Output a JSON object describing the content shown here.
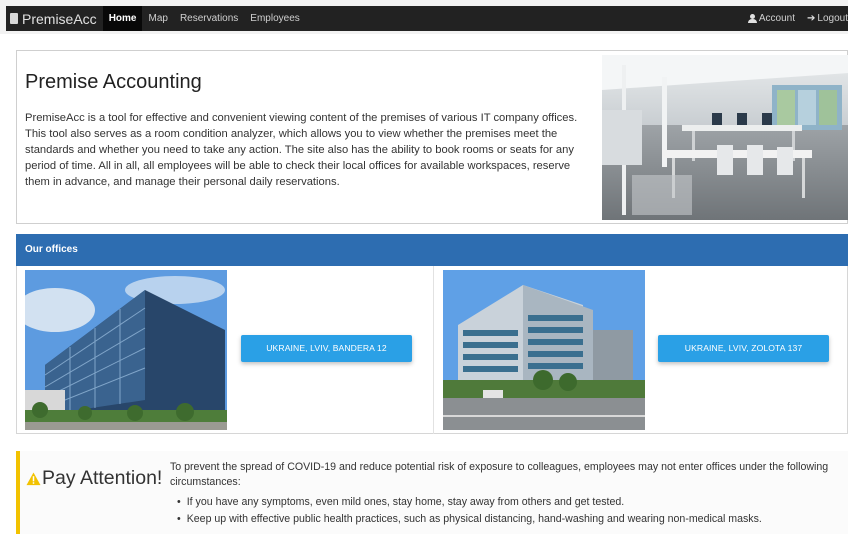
{
  "navbar": {
    "brand": "PremiseAcc",
    "links": [
      "Home",
      "Map",
      "Reservations",
      "Employees"
    ],
    "active": "Home",
    "account_label": "Account",
    "logout_label": "Logout"
  },
  "hero": {
    "title": "Premise Accounting",
    "description": "PremiseAcc is a tool for effective and convenient viewing content of the premises of various IT company offices. This tool also serves as a room condition analyzer, which allows you to view whether the premises meet the standards and whether you need to take any action. The site also has the ability to book rooms or seats for any period of time. All in all, all employees will be able to check their local offices for available workspaces, reserve them in advance, and manage their personal daily reservations."
  },
  "offices": {
    "header": "Our offices",
    "items": [
      {
        "label": "UKRAINE, LVIV, BANDERA 12"
      },
      {
        "label": "UKRAINE, LVIV, ZOLOTA 137"
      }
    ]
  },
  "attention": {
    "title": "Pay Attention!",
    "text": "To prevent the spread of COVID-19 and reduce potential risk of exposure to colleagues, employees may not enter offices under the following circumstances:",
    "items": [
      "If you have any symptoms, even mild ones, stay home, stay away from others and get tested.",
      "Keep up with effective public health practices, such as physical distancing, hand-washing and wearing non-medical masks."
    ]
  },
  "colors": {
    "navbar_bg": "#222222",
    "offices_header_bg": "#2d6db1",
    "button_bg": "#2aa0e6",
    "attention_accent": "#f2c200"
  },
  "icons": {
    "brand": "building-icon",
    "account": "user-icon",
    "logout": "logout-icon",
    "attention": "warning-icon"
  }
}
